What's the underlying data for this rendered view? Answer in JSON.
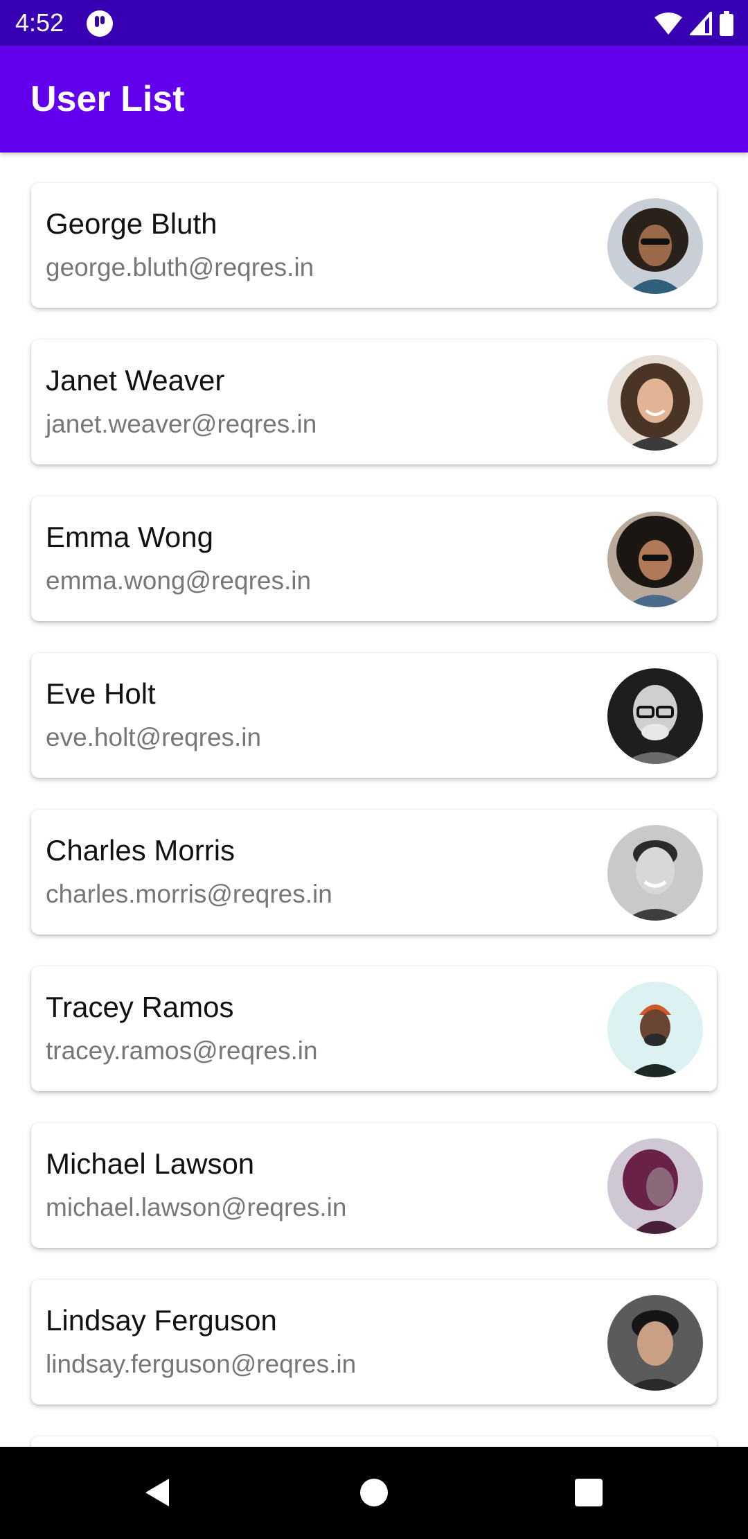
{
  "status_bar": {
    "time": "4:52",
    "app_icon": "app-notification-icon",
    "icons": [
      "wifi-icon",
      "cellular-signal-icon",
      "battery-icon"
    ]
  },
  "app_bar": {
    "title": "User List"
  },
  "users": [
    {
      "name": "George Bluth",
      "email": "george.bluth@reqres.in",
      "avatar": "avatar-photo"
    },
    {
      "name": "Janet Weaver",
      "email": "janet.weaver@reqres.in",
      "avatar": "avatar-photo"
    },
    {
      "name": "Emma Wong",
      "email": "emma.wong@reqres.in",
      "avatar": "avatar-photo"
    },
    {
      "name": "Eve Holt",
      "email": "eve.holt@reqres.in",
      "avatar": "avatar-photo"
    },
    {
      "name": "Charles Morris",
      "email": "charles.morris@reqres.in",
      "avatar": "avatar-photo"
    },
    {
      "name": "Tracey Ramos",
      "email": "tracey.ramos@reqres.in",
      "avatar": "avatar-photo"
    },
    {
      "name": "Michael Lawson",
      "email": "michael.lawson@reqres.in",
      "avatar": "avatar-photo"
    },
    {
      "name": "Lindsay Ferguson",
      "email": "lindsay.ferguson@reqres.in",
      "avatar": "avatar-photo"
    }
  ],
  "nav_bar": {
    "buttons": [
      "back-icon",
      "home-icon",
      "recents-icon"
    ]
  },
  "colors": {
    "status_bar": "#3700b3",
    "app_bar": "#6200ee",
    "card_background": "#ffffff",
    "name_text": "#111111",
    "email_text": "#777777",
    "nav_bar": "#000000"
  }
}
